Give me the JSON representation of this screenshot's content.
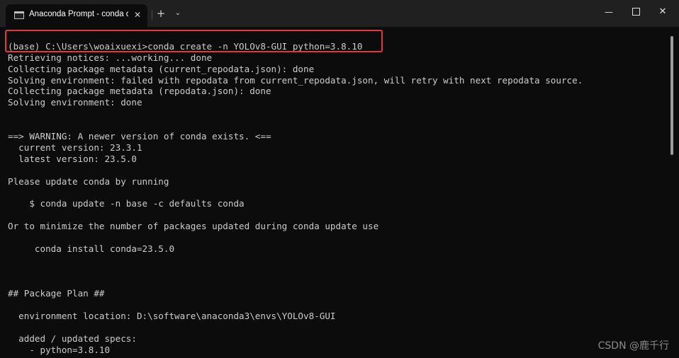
{
  "window": {
    "tab_title": "Anaconda Prompt - conda  cr",
    "close_tab_symbol": "✕",
    "new_tab_symbol": "+",
    "dropdown_symbol": "⌄",
    "minimize_symbol": "—",
    "close_symbol": "✕"
  },
  "terminal": {
    "lines": [
      "",
      "(base) C:\\Users\\woaixuexi>conda create -n YOLOv8-GUI python=3.8.10",
      "Retrieving notices: ...working... done",
      "Collecting package metadata (current_repodata.json): done",
      "Solving environment: failed with repodata from current_repodata.json, will retry with next repodata source.",
      "Collecting package metadata (repodata.json): done",
      "Solving environment: done",
      "",
      "",
      "==> WARNING: A newer version of conda exists. <==",
      "  current version: 23.3.1",
      "  latest version: 23.5.0",
      "",
      "Please update conda by running",
      "",
      "    $ conda update -n base -c defaults conda",
      "",
      "Or to minimize the number of packages updated during conda update use",
      "",
      "     conda install conda=23.5.0",
      "",
      "",
      "",
      "## Package Plan ##",
      "",
      "  environment location: D:\\software\\anaconda3\\envs\\YOLOv8-GUI",
      "",
      "  added / updated specs:",
      "    - python=3.8.10"
    ]
  },
  "watermark": "CSDN @鹿千行",
  "colors": {
    "highlight_border": "#e5383b",
    "terminal_bg": "#0c0c0c",
    "terminal_text": "#cccccc"
  }
}
